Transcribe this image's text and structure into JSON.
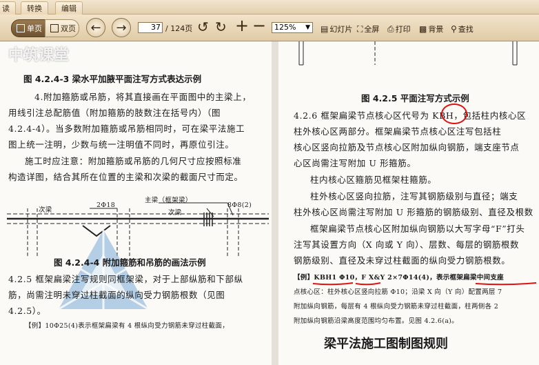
{
  "menu": {
    "items": [
      "读",
      "转换",
      "编辑"
    ]
  },
  "toolbar": {
    "single_page": "单页",
    "double_page": "双页",
    "current_page": "37",
    "total_pages": "/ 124页",
    "zoom": "125%",
    "slideshow": "幻灯片",
    "fullscreen": "全屏",
    "print": "打印",
    "background": "背景",
    "find": "查找"
  },
  "watermark": "中筑课堂",
  "left_page": {
    "fig_title_top": "图 4.2.4-3  梁水平加腋平面注写方式表达示例",
    "para1_lines": [
      "4.附加箍筋或吊筋，将其直接画在平面图中的主梁上，",
      "用线引注总配筋值（附加箍筋的肢数注在括号内）（图",
      "4.2.4-4）。当多数附加箍筋或吊筋相同时，可在梁平法施工",
      "图上统一注明，少数与统一注明值不同时，再原位引注。"
    ],
    "para2_lines": [
      "施工时应注意：附加箍筋或吊筋的几何尺寸应按照标准",
      "构造详图，结合其所在位置的主梁和次梁的截面尺寸而定。"
    ],
    "diagram": {
      "main_beam_label": "主梁（框架梁）",
      "sub_beam_left": "次梁",
      "sub_beam_right": "次梁",
      "bar_left": "2Φ18",
      "bar_right": "8Φ8(2)"
    },
    "fig_title_bottom": "图 4.2.4-4  附加箍筋和吊筋的画法示例",
    "para3_lines": [
      "4.2.5  框架扁梁注写规则同框架梁，对于上部纵筋和下部纵",
      "筋，尚需注明未穿过柱截面的纵向受力钢筋根数（见图",
      "4.2.5）。"
    ],
    "example_line": "【例】10Φ25(4)表示框架扁梁有 4 根纵向受力钢筋未穿过柱截面，"
  },
  "right_page": {
    "fig_title": "图 4.2.5  平面注写方式示例",
    "lines": [
      "4.2.6  框架扁梁节点核心区代号为 KBH，包括柱内核心区",
      "柱外核心区两部分。框架扁梁节点核心区注写包括柱",
      "核心区竖向拉筋及节点核心区附加纵向钢筋，端支座节点",
      "心区尚需注写附加 U 形箍筋。",
      "柱内核心区箍筋见框架柱箍筋。",
      "柱外核心区竖向拉筋，注写其钢筋级别与直径；端支",
      "柱外核心区尚需注写附加 U 形箍筋的钢筋级别、直径及根数",
      "框架扁梁节点核心区附加纵向钢筋以大写字母“F”打头",
      "注写其设置方向（X 向或 Y 向）、层数、每层的钢筋根数",
      "钢筋级别、直径及未穿过柱截面的纵向受力钢筋根数。"
    ],
    "example_lines": [
      "【例】KBH1 Φ10，F X&Y 2×7Φ14(4)，表示框架扁梁中间支座",
      "点核心区：柱外核心区竖向拉筋 Φ10；沿梁 X 向（Y 向）配置两层 7",
      "附加纵向钢筋，每层有 4 根纵向受力钢筋未穿过柱截面，柱两侧各 2",
      "附加纵向钢筋沿梁高度范围均匀布置。见图 4.2.6(a)。"
    ],
    "bottom_heading": "梁平法施工图制图规则"
  }
}
